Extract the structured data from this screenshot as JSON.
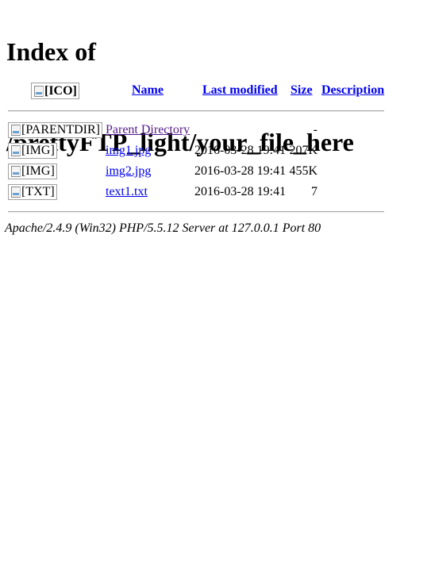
{
  "page": {
    "title_line1": "Index of",
    "title_line2": "/prettyFTP_light/your_file_here"
  },
  "table": {
    "header": {
      "icon_alt": "[ICO]",
      "name": "Name",
      "last_modified": "Last modified",
      "size": "Size",
      "description": "Description"
    },
    "rows": [
      {
        "icon_alt": "[PARENTDIR]",
        "name": "Parent Directory",
        "last_modified": "",
        "size": "-",
        "description": ""
      },
      {
        "icon_alt": "[IMG]",
        "name": "img1.jpg",
        "last_modified": "2016-03-28 19:41",
        "size": "207K",
        "description": ""
      },
      {
        "icon_alt": "[IMG]",
        "name": "img2.jpg",
        "last_modified": "2016-03-28 19:41",
        "size": "455K",
        "description": ""
      },
      {
        "icon_alt": "[TXT]",
        "name": "text1.txt",
        "last_modified": "2016-03-28 19:41",
        "size": "7",
        "description": ""
      }
    ]
  },
  "footer": {
    "signature": "Apache/2.4.9 (Win32) PHP/5.5.12 Server at 127.0.0.1 Port 80"
  }
}
